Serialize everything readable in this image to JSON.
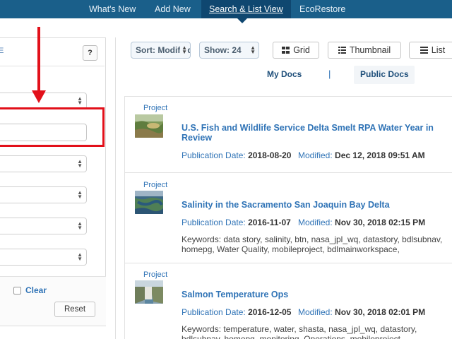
{
  "nav": {
    "items": [
      "What's New",
      "Add New",
      "Search & List View",
      "EcoRestore"
    ],
    "active": "Search & List View"
  },
  "filter_panel": {
    "stray_char": "E",
    "help_label": "?",
    "clear_label": "Clear",
    "reset_label": "Reset"
  },
  "toolbar": {
    "sort_label": "Sort: Modified",
    "show_label": "Show: 24",
    "grid_label": "Grid",
    "thumbnail_label": "Thumbnail",
    "list_label": "List"
  },
  "doc_tabs": {
    "my_docs": "My Docs",
    "separator": "|",
    "public_docs": "Public Docs"
  },
  "results": [
    {
      "kind": "Project",
      "title": "U.S. Fish and Wildlife Service Delta Smelt RPA Water Year in Review",
      "pub_label": "Publication Date:",
      "pub_date": "2018-08-20",
      "mod_label": "Modified:",
      "mod_date": "Dec 12, 2018 09:51 AM",
      "keywords": ""
    },
    {
      "kind": "Project",
      "title": "Salinity in the Sacramento San Joaquin Bay Delta",
      "pub_label": "Publication Date:",
      "pub_date": "2016-11-07",
      "mod_label": "Modified:",
      "mod_date": "Nov 30, 2018 02:15 PM",
      "keywords": "Keywords: data story, salinity, btn, nasa_jpl_wq, datastory, bdlsubnav, homepg, Water Quality, mobileproject, bdlmainworkspace,"
    },
    {
      "kind": "Project",
      "title": "Salmon Temperature Ops",
      "pub_label": "Publication Date:",
      "pub_date": "2016-12-05",
      "mod_label": "Modified:",
      "mod_date": "Nov 30, 2018 02:01 PM",
      "keywords": "Keywords: temperature, water, shasta, nasa_jpl_wq, datastory, bdlsubnav, homepg, monitoring, Operations, mobileproject,"
    }
  ],
  "colors": {
    "nav_bg": "#1a5f8a",
    "nav_active": "#0f4770",
    "link": "#2f73b6",
    "annotation_red": "#e2101a"
  }
}
